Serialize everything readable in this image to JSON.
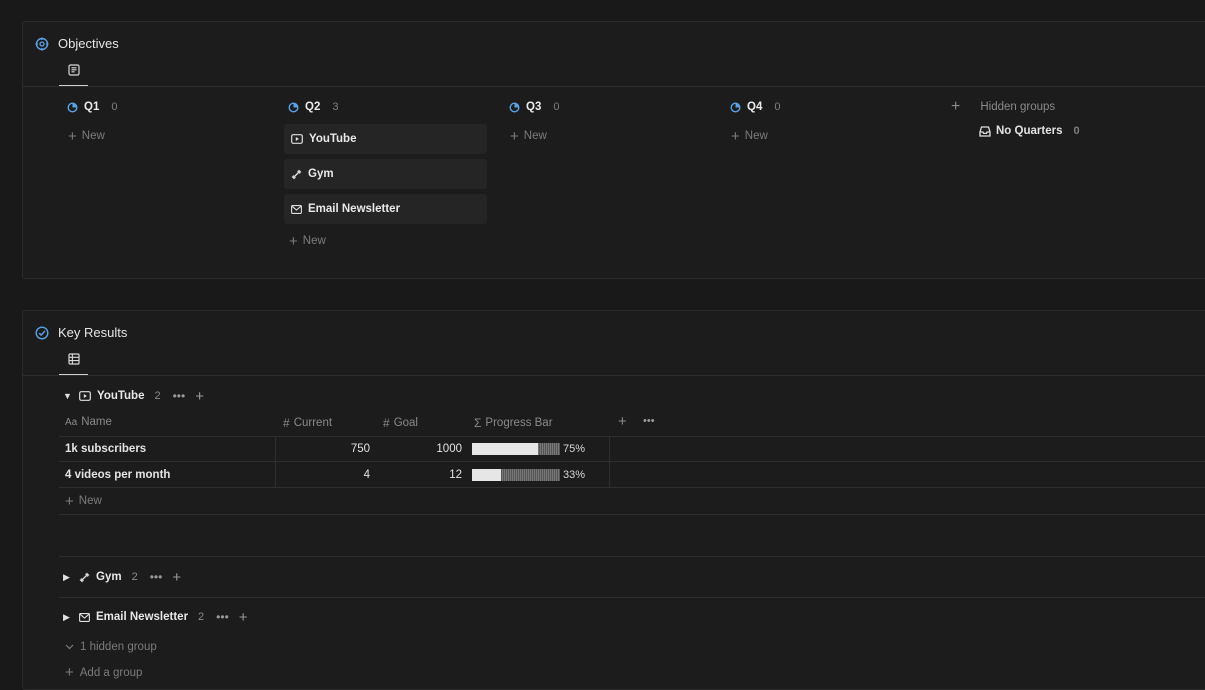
{
  "objectives": {
    "title": "Objectives",
    "columns": [
      {
        "label": "Q1",
        "count": "0",
        "cards": [],
        "new_label": "New"
      },
      {
        "label": "Q2",
        "count": "3",
        "cards": [
          {
            "label": "YouTube",
            "icon": "play-icon"
          },
          {
            "label": "Gym",
            "icon": "dumbbell-icon"
          },
          {
            "label": "Email Newsletter",
            "icon": "mail-icon"
          }
        ],
        "new_label": "New"
      },
      {
        "label": "Q3",
        "count": "0",
        "cards": [],
        "new_label": "New"
      },
      {
        "label": "Q4",
        "count": "0",
        "cards": [],
        "new_label": "New"
      }
    ],
    "hidden_groups_label": "Hidden groups",
    "hidden_group": {
      "label": "No Quarters",
      "count": "0"
    }
  },
  "key_results": {
    "title": "Key Results",
    "groups": [
      {
        "label": "YouTube",
        "count": "2",
        "expanded": true
      },
      {
        "label": "Gym",
        "count": "2",
        "expanded": false
      },
      {
        "label": "Email Newsletter",
        "count": "2",
        "expanded": false
      }
    ],
    "columns": {
      "name": "Name",
      "current": "Current",
      "goal": "Goal",
      "progress": "Progress Bar"
    },
    "rows": [
      {
        "name": "1k subscribers",
        "current": "750",
        "goal": "1000",
        "progress": 0.75,
        "progress_label": "75%"
      },
      {
        "name": "4 videos per month",
        "current": "4",
        "goal": "12",
        "progress": 0.33,
        "progress_label": "33%"
      }
    ],
    "new_label": "New",
    "hidden_group_label": "1 hidden group",
    "add_group_label": "Add a group"
  },
  "colors": {
    "background": "#191919",
    "panel": "#1c1c1c",
    "card": "#252525",
    "accent": "#5aa2e6"
  }
}
